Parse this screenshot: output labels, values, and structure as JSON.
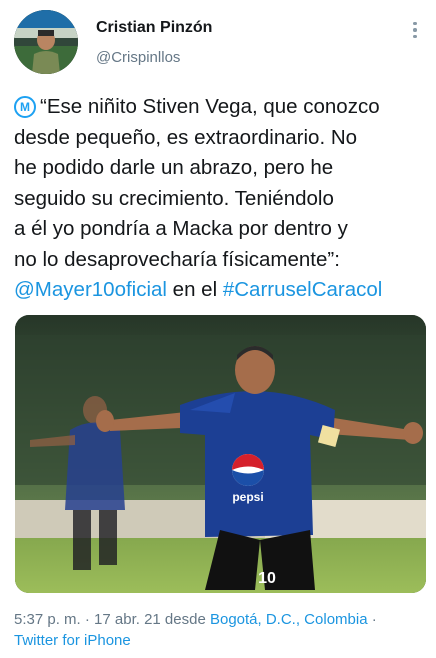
{
  "author": {
    "name": "Cristian Pinzón",
    "handle": "@Crispinllos"
  },
  "icons": {
    "more": "more-vertical-icon",
    "badge": "millonarios-m-icon"
  },
  "tweet": {
    "badge_letter": "M",
    "lines": [
      "“Ese niñito Stiven Vega, que conozco",
      "desde pequeño, es extraordinario. No",
      "he podido darle un abrazo, pero he",
      "seguido su crecimiento. Teniéndolo",
      "a él yo pondría a Macka por dentro y",
      "no lo desaprovecharía físicamente”:"
    ],
    "mention": "@Mayer10oficial",
    "connector": " en el ",
    "hashtag": "#CarruselCaracol"
  },
  "media": {
    "jersey_sponsor": "pepsi",
    "jersey_number": "10"
  },
  "meta": {
    "time_date": "5:37 p. m. · 17 abr. 21 desde ",
    "location": "Bogotá, D.C., Colombia",
    "separator": " ·",
    "client": "Twitter for iPhone"
  },
  "colors": {
    "link": "#1b95e0",
    "muted": "#657786",
    "jersey_blue": "#1c3f94"
  }
}
